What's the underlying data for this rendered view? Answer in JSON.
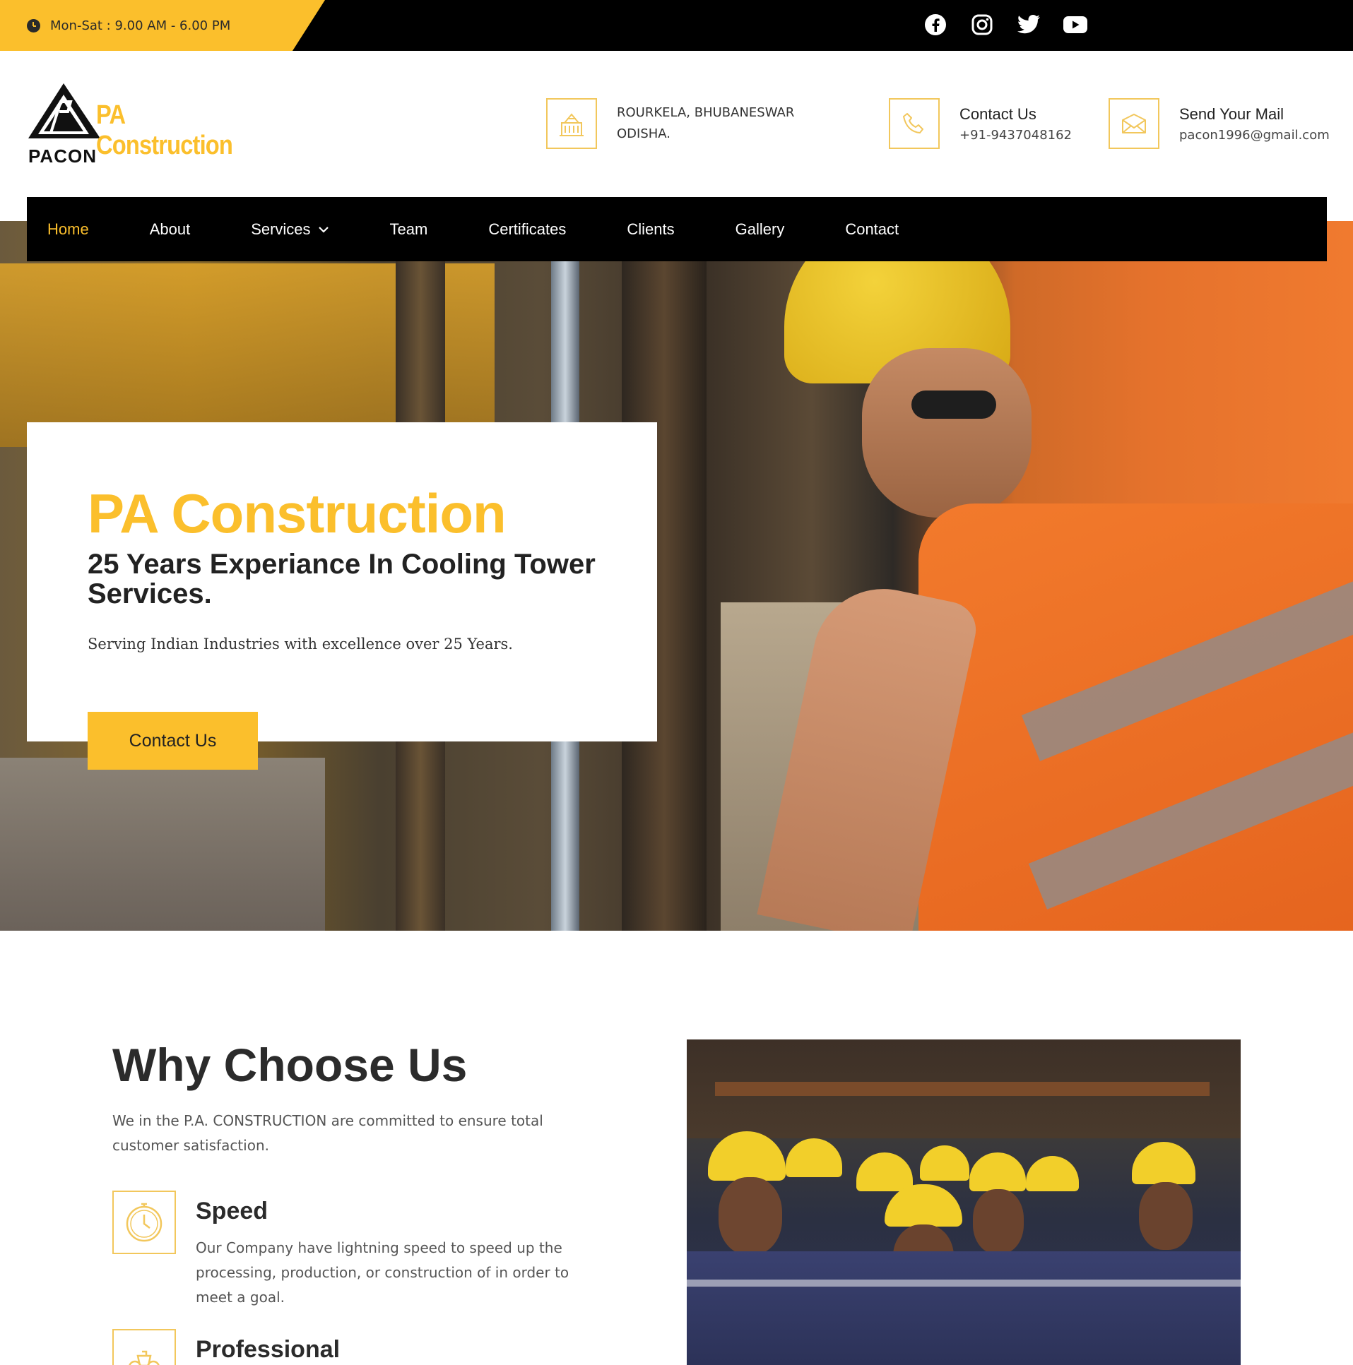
{
  "topbar": {
    "hours": "Mon-Sat : 9.00 AM - 6.00 PM",
    "social": [
      "facebook-icon",
      "instagram-icon",
      "twitter-icon",
      "youtube-icon"
    ]
  },
  "header": {
    "logo_brand": "PA Construction",
    "logo_short": "PACON",
    "address_line1": "ROURKELA, BHUBANESWAR",
    "address_line2": "ODISHA.",
    "contact_heading": "Contact Us",
    "contact_phone": "+91-9437048162",
    "mail_heading": "Send Your Mail",
    "mail_address": "pacon1996@gmail.com"
  },
  "nav": {
    "items": [
      {
        "label": "Home",
        "active": true
      },
      {
        "label": "About"
      },
      {
        "label": "Services",
        "dropdown": true
      },
      {
        "label": "Team"
      },
      {
        "label": "Certificates"
      },
      {
        "label": "Clients"
      },
      {
        "label": "Gallery"
      },
      {
        "label": "Contact"
      }
    ]
  },
  "hero": {
    "title": "PA Construction",
    "subtitle": "25 Years Experiance In Cooling Tower Services.",
    "description": "Serving Indian Industries with excellence over 25 Years.",
    "cta_label": "Contact Us"
  },
  "why": {
    "title": "Why Choose Us",
    "intro": "We in the P.A. CONSTRUCTION are committed to ensure total customer satisfaction.",
    "features": [
      {
        "icon": "clock-icon",
        "heading": "Speed",
        "text": "Our Company have lightning speed to speed up the processing, production, or construction of in order to meet a goal."
      },
      {
        "icon": "professional-icon",
        "heading": "Professional",
        "text": ""
      }
    ]
  },
  "colors": {
    "accent": "#fbbf2c",
    "dark": "#000000",
    "text": "#222222"
  }
}
